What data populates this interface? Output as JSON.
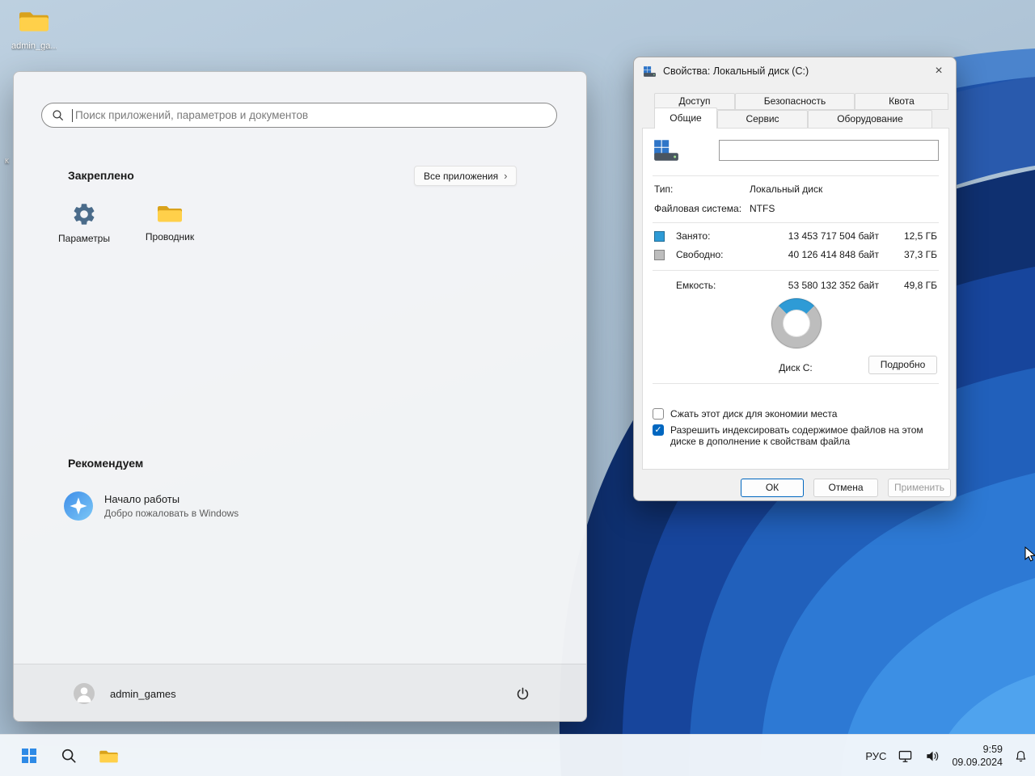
{
  "colors": {
    "accent": "#0067c0",
    "start_logo": "#2e8ae6",
    "used": "#2e9bd6",
    "free": "#bdbdbd"
  },
  "icons": {
    "close": "×",
    "chevron": "›",
    "check": "✓"
  },
  "desktop": {
    "icon_label": "admin_ga...",
    "partial_label": "к"
  },
  "start_menu": {
    "search_placeholder": "Поиск приложений, параметров и документов",
    "pinned_header": "Закреплено",
    "all_apps": "Все приложения",
    "pinned": [
      {
        "label": "Параметры"
      },
      {
        "label": "Проводник"
      }
    ],
    "recommended_header": "Рекомендуем",
    "recommended_item": {
      "title": "Начало работы",
      "subtitle": "Добро пожаловать в Windows"
    },
    "user": "admin_games"
  },
  "dialog": {
    "title": "Свойства: Локальный диск (C:)",
    "tabs_row1": [
      "Доступ",
      "Безопасность",
      "Квота"
    ],
    "tabs_row2": [
      "Общие",
      "Сервис",
      "Оборудование"
    ],
    "active_tab": "Общие",
    "volume_label": "",
    "type_label": "Тип:",
    "type_value": "Локальный диск",
    "fs_label": "Файловая система:",
    "fs_value": "NTFS",
    "used": {
      "label": "Занято:",
      "bytes": "13 453 717 504 байт",
      "size": "12,5 ГБ"
    },
    "free": {
      "label": "Свободно:",
      "bytes": "40 126 414 848 байт",
      "size": "37,3 ГБ"
    },
    "capacity": {
      "label": "Емкость:",
      "bytes": "53 580 132 352 байт",
      "size": "49,8 ГБ"
    },
    "chart": {
      "type": "pie",
      "label": "Диск C:",
      "used_percent": 25.1,
      "free_percent": 74.9
    },
    "details_button": "Подробно",
    "compress_checkbox": {
      "label": "Сжать этот диск для экономии места",
      "checked": false
    },
    "index_checkbox": {
      "label": "Разрешить индексировать содержимое файлов на этом диске в дополнение к свойствам файла",
      "checked": true
    },
    "ok": "ОК",
    "cancel": "Отмена",
    "apply": "Применить"
  },
  "taskbar": {
    "language": "РУС",
    "time": "9:59",
    "date": "09.09.2024"
  }
}
